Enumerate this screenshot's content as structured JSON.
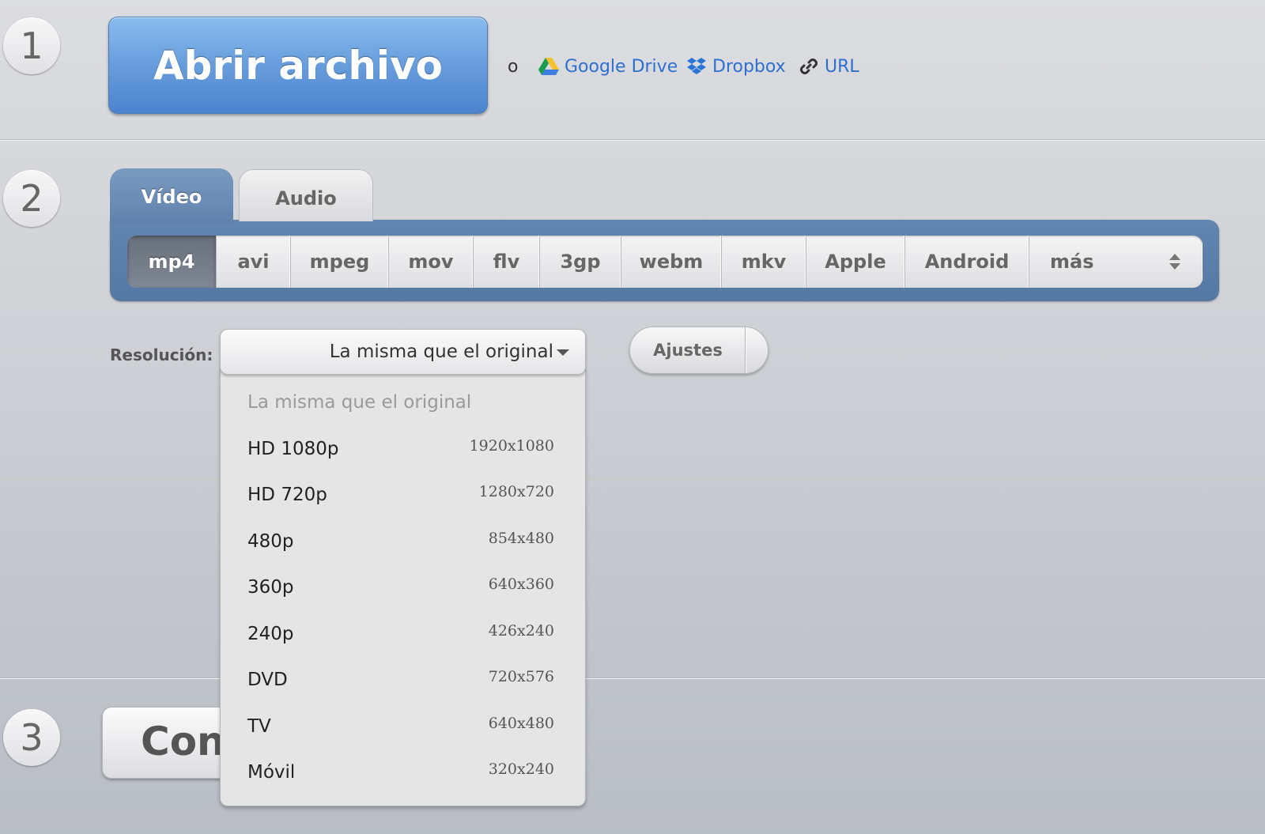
{
  "steps": {
    "one": "1",
    "two": "2",
    "three": "3"
  },
  "open": {
    "button_label": "Abrir archivo",
    "or_text": "o",
    "sources": [
      {
        "label": "Google Drive",
        "icon": "google-drive-icon"
      },
      {
        "label": "Dropbox",
        "icon": "dropbox-icon"
      },
      {
        "label": "URL",
        "icon": "link-icon"
      }
    ]
  },
  "tabs": [
    {
      "label": "Vídeo",
      "active": true
    },
    {
      "label": "Audio",
      "active": false
    }
  ],
  "formats": [
    "mp4",
    "avi",
    "mpeg",
    "mov",
    "flv",
    "3gp",
    "webm",
    "mkv",
    "Apple",
    "Android",
    "más"
  ],
  "selected_format": "mp4",
  "resolution": {
    "label": "Resolución:",
    "selected": "La misma que el original",
    "options": [
      {
        "name": "La misma que el original",
        "dims": ""
      },
      {
        "name": "HD 1080p",
        "dims": "1920x1080"
      },
      {
        "name": "HD 720p",
        "dims": "1280x720"
      },
      {
        "name": "480p",
        "dims": "854x480"
      },
      {
        "name": "360p",
        "dims": "640x360"
      },
      {
        "name": "240p",
        "dims": "426x240"
      },
      {
        "name": "DVD",
        "dims": "720x576"
      },
      {
        "name": "TV",
        "dims": "640x480"
      },
      {
        "name": "Móvil",
        "dims": "320x240"
      }
    ]
  },
  "settings": {
    "label": "Ajustes"
  },
  "convert": {
    "label": "Convertir",
    "visible_text": "Conv"
  },
  "colors": {
    "accent_blue": "#4c83ce",
    "link_blue": "#2e6fcf",
    "panel_blue": "#5f82ad"
  }
}
